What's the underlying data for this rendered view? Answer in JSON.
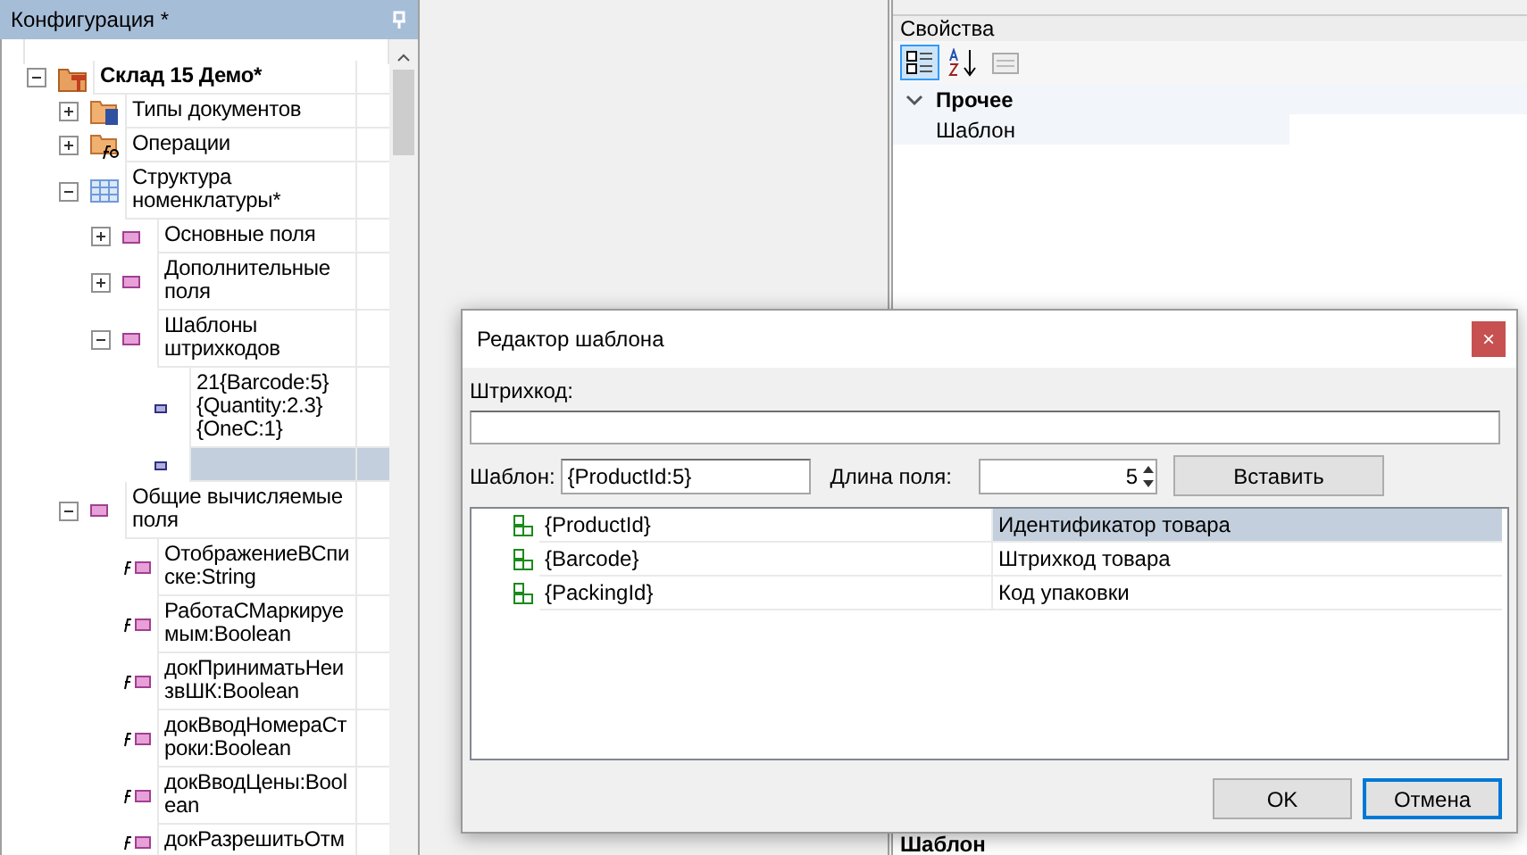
{
  "config_panel": {
    "title": "Конфигурация *",
    "tree": [
      {
        "label": "Склад 15 Демо*",
        "kind": "root",
        "bold": true,
        "expanded": true,
        "selected": false,
        "children": [
          {
            "label": "Типы документов",
            "kind": "doc-types",
            "expanded": false,
            "selected": false
          },
          {
            "label": "Операции",
            "kind": "operations",
            "expanded": false,
            "selected": false
          },
          {
            "label": "Структура номенклатуры*",
            "kind": "structure",
            "expanded": true,
            "selected": false,
            "children": [
              {
                "label": "Основные поля",
                "kind": "group",
                "expanded": false,
                "selected": false
              },
              {
                "label": "Дополнительные поля",
                "kind": "group",
                "expanded": false,
                "selected": false
              },
              {
                "label": "Шаблоны штрихкодов",
                "kind": "group",
                "expanded": true,
                "selected": false,
                "children": [
                  {
                    "label": "21{Barcode:5}{Quantity:2.3}{OneC:1}",
                    "kind": "template",
                    "selected": false
                  },
                  {
                    "kind": "template",
                    "selected": true
                  }
                ]
              }
            ]
          },
          {
            "label": "Общие вычисляемые поля",
            "kind": "group",
            "expanded": true,
            "selected": false,
            "children": [
              {
                "label": "ОтображениеВСписке:String",
                "kind": "computed",
                "selected": false
              },
              {
                "label": "РаботаСМаркируемым:Boolean",
                "kind": "computed",
                "selected": false
              },
              {
                "label": "докПриниматьНеизвШК:Boolean",
                "kind": "computed",
                "selected": false
              },
              {
                "label": "докВводНомераСтроки:Boolean",
                "kind": "computed",
                "selected": false
              },
              {
                "label": "докВводЦены:Boolean",
                "kind": "computed",
                "selected": false
              },
              {
                "label": "докРазрешитьОтм",
                "kind": "computed",
                "selected": false
              }
            ]
          }
        ]
      }
    ]
  },
  "properties_panel": {
    "title": "Свойства",
    "toolbar": [
      {
        "kind": "categorized",
        "selected": true
      },
      {
        "kind": "alphabetical",
        "selected": false
      },
      {
        "kind": "pages",
        "selected": false
      }
    ],
    "category": "Прочее",
    "property": "Шаблон",
    "description_title": "Шаблон"
  },
  "dialog": {
    "title": "Редактор шаблона",
    "close": "×",
    "barcode_label": "Штрихкод:",
    "template_label": "Шаблон:",
    "template_value": "{ProductId:5}",
    "length_label": "Длина поля:",
    "length_value": "5",
    "insert_button": "Вставить",
    "fields": [
      {
        "name": "{ProductId}",
        "description": "Идентификатор товара",
        "selected": true
      },
      {
        "name": "{Barcode}",
        "description": "Штрихкод товара",
        "selected": false
      },
      {
        "name": "{PackingId}",
        "description": "Код упаковки",
        "selected": false
      }
    ],
    "buttons": [
      {
        "label": "OK",
        "focused": false
      },
      {
        "label": "Отмена",
        "focused": true
      }
    ]
  }
}
